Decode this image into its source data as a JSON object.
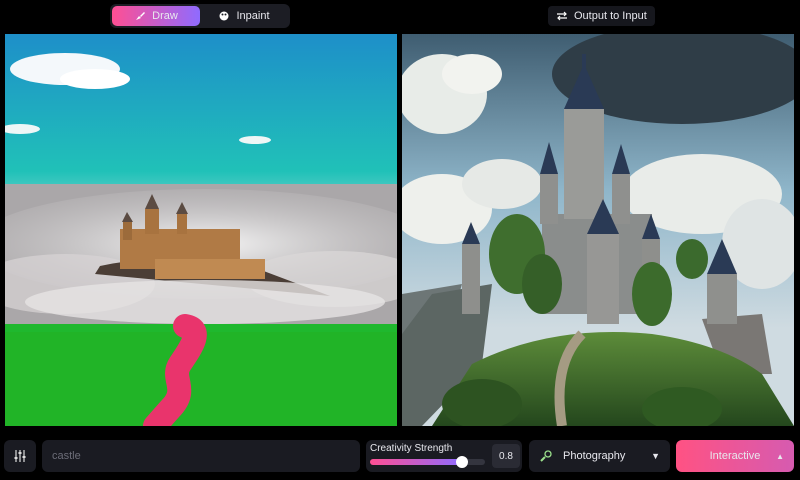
{
  "top_bar": {
    "mode_tabs": [
      {
        "label": "Draw",
        "icon": "brush-icon",
        "active": true
      },
      {
        "label": "Inpaint",
        "icon": "palette-icon",
        "active": false
      }
    ],
    "output_to_input_label": "Output to Input",
    "output_to_input_icon": "swap-arrows-icon"
  },
  "canvas": {
    "sketch_alt": "castle sketch canvas",
    "result_alt": "generated castle image"
  },
  "controls": {
    "settings_icon": "sliders-icon",
    "prompt_value": "",
    "prompt_placeholder": "castle",
    "creativity_label": "Creativity Strength",
    "creativity_value": "0.8",
    "creativity_fraction": 0.8,
    "style_label": "Photography",
    "style_icon": "camera-icon",
    "mode_button_label": "Interactive"
  },
  "colors": {
    "accent_pink": "#ff4f93",
    "accent_purple": "#8f6bff",
    "background": "#000000",
    "control_bg": "#1a1b22"
  }
}
